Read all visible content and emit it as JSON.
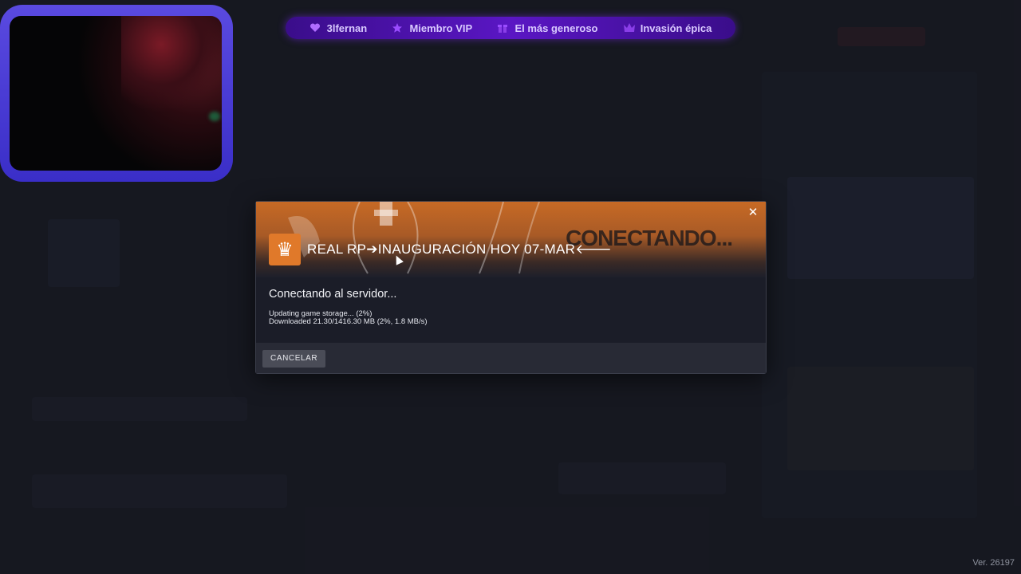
{
  "banner": {
    "items": [
      {
        "label": "3lfernan",
        "icon": "heart-icon"
      },
      {
        "label": "Miembro VIP",
        "icon": "star-icon"
      },
      {
        "label": "El más generoso",
        "icon": "gift-icon"
      },
      {
        "label": "Invasión épica",
        "icon": "crown-icon"
      }
    ]
  },
  "dialog": {
    "title": "REAL RP➔INAUGURACIÓN HOY 07-MAR🡐",
    "bg_word": "CONECTANDO...",
    "status": "Conectando al servidor...",
    "detail_line1": "Updating game storage... (2%)",
    "detail_line2": "Downloaded 21.30/1416.30 MB (2%, 1.8 MB/s)",
    "progress_percent": 2,
    "cancel_label": "CANCELAR"
  },
  "version": "Ver. 26197",
  "colors": {
    "accent": "#e0792a",
    "banner": "#5a16c4",
    "webcam_frame": "#4a3ed8"
  }
}
